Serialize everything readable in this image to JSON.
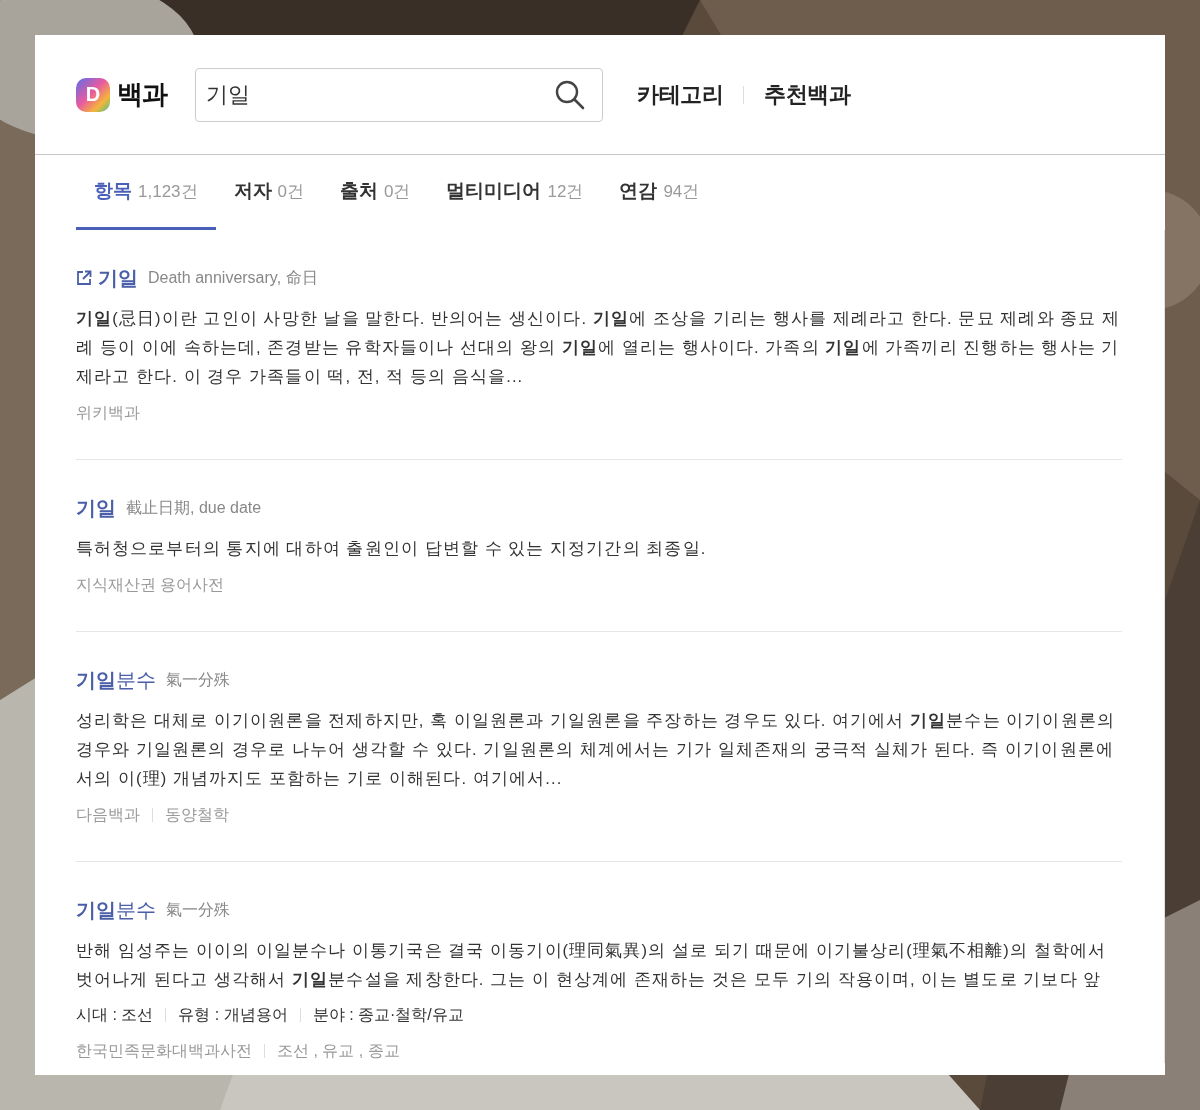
{
  "header": {
    "logo": {
      "mark": "D",
      "text": "백과"
    },
    "search": {
      "value": "기일"
    },
    "nav": [
      "카테고리",
      "추천백과"
    ]
  },
  "tabs": [
    {
      "label": "항목",
      "count": "1,123건",
      "selected": true
    },
    {
      "label": "저자",
      "count": "0건",
      "selected": false
    },
    {
      "label": "출처",
      "count": "0건",
      "selected": false
    },
    {
      "label": "멀티미디어",
      "count": "12건",
      "selected": false
    },
    {
      "label": "연감",
      "count": "94건",
      "selected": false
    }
  ],
  "results": [
    {
      "title": "**기일**",
      "external_link": true,
      "subtitle": "Death anniversary, 命日",
      "body": "**기일**(忌日)이란 고인이 사망한 날을 말한다. 반의어는 생신이다. **기일**에 조상을 기리는 행사를 제례라고 한다. 문묘 제례와 종묘 제례 등이 이에 속하는데, 존경받는 유학자들이나 선대의 왕의 **기일**에 열리는 행사이다. 가족의 **기일**에 가족끼리 진행하는 행사는 기제라고 한다. 이 경우 가족들이 떡, 전, 적 등의 음식을...",
      "sources": [
        "위키백과"
      ]
    },
    {
      "title": "**기일**",
      "external_link": false,
      "subtitle": "截止日期, due date",
      "body": "특허청으로부터의 통지에 대하여 출원인이 답변할 수 있는 지정기간의 최종일.",
      "sources": [
        "지식재산권 용어사전"
      ]
    },
    {
      "title": "**기일**분수",
      "external_link": false,
      "subtitle": "氣一分殊",
      "body": "성리학은 대체로 이기이원론을 전제하지만, 혹 이일원론과 기일원론을 주장하는 경우도 있다. 여기에서 **기일**분수는 이기이원론의 경우와 기일원론의 경우로 나누어 생각할 수 있다. 기일원론의 체계에서는 기가 일체존재의 궁극적 실체가 된다. 즉 이기이원론에서의 이(理) 개념까지도 포함하는 기로 이해된다. 여기에서...",
      "sources": [
        "다음백과",
        "동양철학"
      ]
    },
    {
      "title": "**기일**분수",
      "external_link": false,
      "subtitle": "氣一分殊",
      "body": "반해 임성주는 이이의 이일분수나 이통기국은 결국 이동기이(理同氣異)의 설로 되기 때문에 이기불상리(理氣不相離)의 철학에서 벗어나게 된다고 생각해서 **기일**분수설을 제창한다. 그는 이 현상계에 존재하는 것은 모두 기의 작용이며, 이는 별도로 기보다 앞",
      "meta": [
        "시대 : 조선",
        "유형 : 개념용어",
        "분야 : 종교·철학/유교"
      ],
      "sources": [
        "한국민족문화대백과사전",
        "조선 , 유교 , 종교"
      ]
    }
  ]
}
